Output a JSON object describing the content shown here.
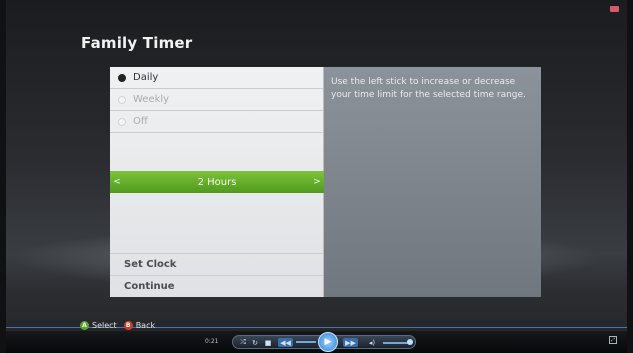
{
  "page": {
    "title": "Family Timer"
  },
  "options": [
    {
      "label": "Daily",
      "selected": true
    },
    {
      "label": "Weekly",
      "selected": false
    },
    {
      "label": "Off",
      "selected": false
    }
  ],
  "time_selector": {
    "value": "2 Hours",
    "left_arrow": "<",
    "right_arrow": ">"
  },
  "actions": {
    "set_clock": "Set Clock",
    "continue": "Continue"
  },
  "description": "Use the left stick to increase or decrease your time limit for the selected time range.",
  "hints": {
    "a_key": "A",
    "select": "Select",
    "b_key": "B",
    "back": "Back"
  },
  "media": {
    "elapsed": "0:21"
  },
  "colors": {
    "accent_green": "#5fae27",
    "panel_blue_gray": "#7d848c",
    "hint_line": "#3f77b8"
  }
}
